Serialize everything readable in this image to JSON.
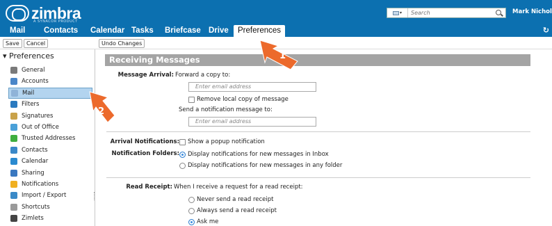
{
  "brand": {
    "name": "zimbra",
    "tagline": "A SYNACOR PRODUCT"
  },
  "search": {
    "placeholder": "Search",
    "type_icon": "mail-icon"
  },
  "user": {
    "name": "Mark Nichols"
  },
  "tabs": [
    {
      "label": "Mail"
    },
    {
      "label": "Contacts"
    },
    {
      "label": "Calendar"
    },
    {
      "label": "Tasks"
    },
    {
      "label": "Briefcase"
    },
    {
      "label": "Drive"
    },
    {
      "label": "Preferences",
      "active": true
    }
  ],
  "toolbar": {
    "save": "Save",
    "cancel": "Cancel",
    "undo": "Undo Changes"
  },
  "sidebar": {
    "title": "Preferences",
    "items": [
      {
        "label": "General",
        "icon": "gear-icon",
        "color": "#7a7a7a"
      },
      {
        "label": "Accounts",
        "icon": "accounts-icon",
        "color": "#4a86c8"
      },
      {
        "label": "Mail",
        "icon": "mail-icon",
        "color": "#8fb3d8",
        "selected": true
      },
      {
        "label": "Filters",
        "icon": "filter-icon",
        "color": "#2a7abf"
      },
      {
        "label": "Signatures",
        "icon": "signature-icon",
        "color": "#c9a24a"
      },
      {
        "label": "Out of Office",
        "icon": "out-of-office-icon",
        "color": "#4aa0d8"
      },
      {
        "label": "Trusted Addresses",
        "icon": "shield-check-icon",
        "color": "#3fae3f"
      },
      {
        "label": "Contacts",
        "icon": "contacts-icon",
        "color": "#3a88c8"
      },
      {
        "label": "Calendar",
        "icon": "calendar-icon",
        "color": "#2a8ad0"
      },
      {
        "label": "Sharing",
        "icon": "sharing-icon",
        "color": "#3a78c0"
      },
      {
        "label": "Notifications",
        "icon": "bell-icon",
        "color": "#f0b020"
      },
      {
        "label": "Import / Export",
        "icon": "import-export-icon",
        "color": "#3a8ac8"
      },
      {
        "label": "Shortcuts",
        "icon": "keyboard-icon",
        "color": "#9a9a9a"
      },
      {
        "label": "Zimlets",
        "icon": "zimlets-icon",
        "color": "#444444"
      }
    ]
  },
  "main": {
    "section_title": "Receiving Messages",
    "message_arrival": {
      "label": "Message Arrival:",
      "forward_label": "Forward a copy to:",
      "forward_placeholder": "Enter email address",
      "remove_local": "Remove local copy of message",
      "notify_label": "Send a notification message to:",
      "notify_placeholder": "Enter email address"
    },
    "arrival_notifications": {
      "label": "Arrival Notifications:",
      "option": "Show a popup notification"
    },
    "notification_folders": {
      "label": "Notification Folders:",
      "options": [
        {
          "label": "Display notifications for new messages in Inbox",
          "selected": true
        },
        {
          "label": "Display notifications for new messages in any folder",
          "selected": false
        }
      ]
    },
    "read_receipt": {
      "label": "Read Receipt:",
      "prompt": "When I receive a request for a read receipt:",
      "options": [
        {
          "label": "Never send a read receipt",
          "selected": false
        },
        {
          "label": "Always send a read receipt",
          "selected": false
        },
        {
          "label": "Ask me",
          "selected": true
        }
      ]
    }
  },
  "callouts": [
    {
      "number": "1"
    },
    {
      "number": "2"
    }
  ],
  "colors": {
    "brand_blue": "#0c70b0",
    "header_gray": "#a4a4a4",
    "selection": "#b3d4ef",
    "callout_orange": "#ec6a2c"
  }
}
